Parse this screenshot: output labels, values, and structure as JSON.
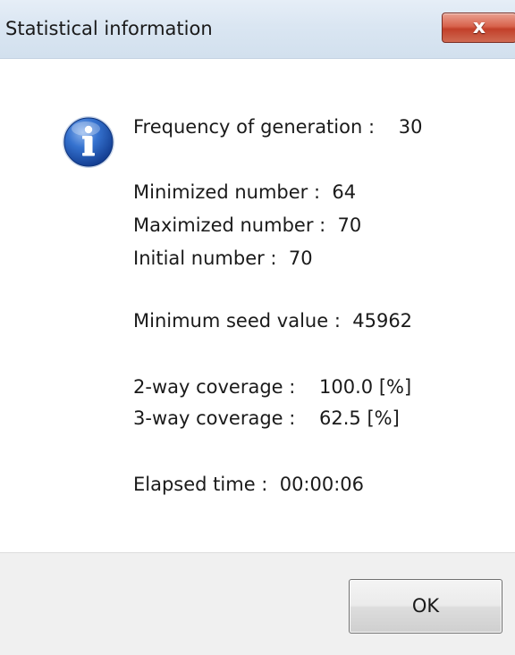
{
  "window": {
    "title": "Statistical information",
    "close_glyph": "x"
  },
  "message": {
    "icon": "information-icon",
    "frequency_of_generation": "Frequency of generation :    30",
    "minimized_number": "Minimized number :  64",
    "maximized_number": "Maximized number :  70",
    "initial_number": "Initial number :  70",
    "minimum_seed_value": "Minimum seed value :  45962",
    "two_way_coverage": "2-way coverage :    100.0 [%]",
    "three_way_coverage": "3-way coverage :    62.5 [%]",
    "elapsed_time": "Elapsed time :  00:00:06"
  },
  "buttons": {
    "ok_label": "OK"
  },
  "colors": {
    "titlebar": "#dae6f2",
    "close_button": "#c94a34",
    "footer": "#f0f0f0",
    "icon_blue": "#1f57b4"
  }
}
